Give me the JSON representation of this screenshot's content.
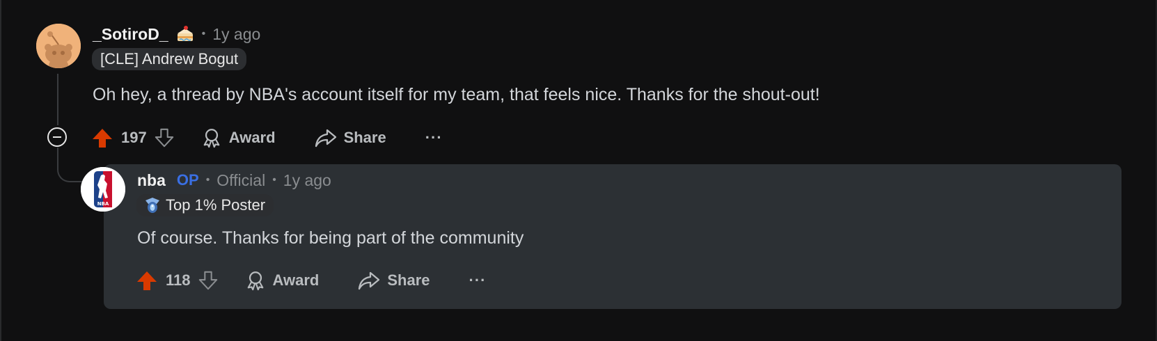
{
  "comment": {
    "username": "_SotiroD_",
    "separator": "•",
    "time": "1y ago",
    "flair": "[CLE] Andrew Bogut",
    "body": "Oh hey, a thread by NBA's account itself for my team, that feels nice. Thanks for the shout-out!",
    "score": "197",
    "award_label": "Award",
    "share_label": "Share",
    "more_label": "···",
    "upvote_color": "#d93a00"
  },
  "reply": {
    "username": "nba",
    "op_badge": "OP",
    "separator": "•",
    "official": "Official",
    "time": "1y ago",
    "flair": "Top 1% Poster",
    "body": "Of course. Thanks for being part of the community",
    "score": "118",
    "award_label": "Award",
    "share_label": "Share",
    "more_label": "···",
    "upvote_color": "#d93a00"
  },
  "icons": {
    "collapse": "minus-circle-icon",
    "upvote": "arrow-up-icon",
    "downvote": "arrow-down-icon",
    "award": "award-ribbon-icon",
    "share": "share-arrow-icon",
    "cake_day": "cake-icon",
    "flair_badge": "top-poster-icon"
  }
}
